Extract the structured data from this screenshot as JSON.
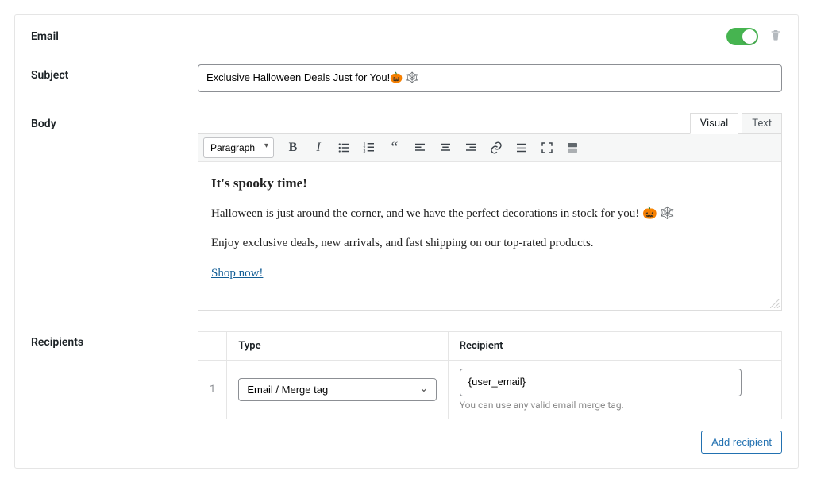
{
  "header": {
    "title": "Email",
    "toggle_on": true
  },
  "subject": {
    "label": "Subject",
    "value": "Exclusive Halloween Deals Just for You!🎃 🕸️"
  },
  "body": {
    "label": "Body",
    "tabs": {
      "visual": "Visual",
      "text": "Text",
      "active": "visual"
    },
    "format_select": "Paragraph",
    "content": {
      "heading": "It's spooky time!",
      "p1": "Halloween is just around the corner, and we have the perfect decorations in stock for you! 🎃 🕸️",
      "p2": "Enjoy exclusive deals, new arrivals, and fast shipping on our top-rated products.",
      "link": "Shop now!"
    }
  },
  "recipients": {
    "label": "Recipients",
    "columns": {
      "type": "Type",
      "recipient": "Recipient"
    },
    "rows": [
      {
        "index": "1",
        "type_value": "Email / Merge tag",
        "recipient_value": "{user_email}",
        "helper": "You can use any valid email merge tag."
      }
    ],
    "add_button": "Add recipient"
  }
}
